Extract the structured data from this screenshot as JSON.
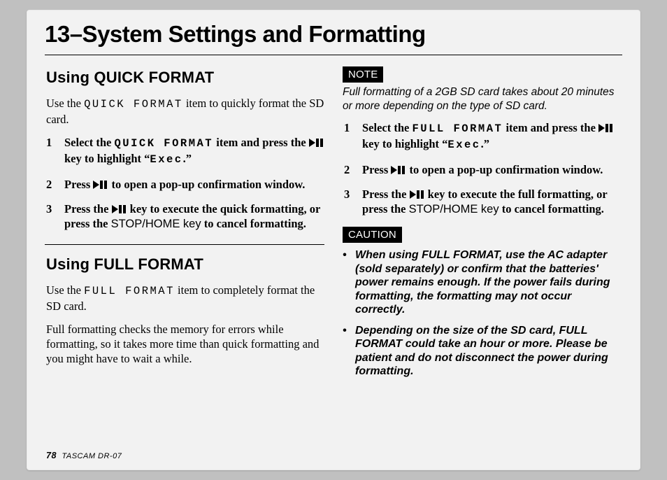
{
  "chapter_title": "13–System Settings and Formatting",
  "left": {
    "quick": {
      "heading": "Using QUICK FORMAT",
      "intro_a": "Use the ",
      "intro_code": "QUICK FORMAT",
      "intro_b": " item to quickly format the SD card.",
      "steps": [
        {
          "a": "Select the ",
          "code": "QUICK FORMAT",
          "b": " item and press the ",
          "c": " key to highlight “",
          "code2": "Exec",
          "d": ".”"
        },
        {
          "a": "Press ",
          "b": " to open a pop-up confirmation window."
        },
        {
          "a": "Press the ",
          "b": " key to execute the quick formatting, or press the ",
          "key": "STOP/HOME key",
          "c": " to cancel formatting."
        }
      ]
    },
    "full": {
      "heading": "Using FULL FORMAT",
      "intro_a": "Use the ",
      "intro_code": "FULL FORMAT",
      "intro_b": " item to completely format the SD card.",
      "para2": "Full formatting checks the memory for errors while formatting, so it takes more time than quick formatting and you might have to wait a while."
    }
  },
  "right": {
    "note_label": "NOTE",
    "note_text": "Full formatting of a 2GB SD card takes about 20 minutes or more depending on the type of SD card.",
    "steps": [
      {
        "a": "Select the ",
        "code": "FULL FORMAT",
        "b": " item and press the ",
        "c": " key to highlight “",
        "code2": "Exec",
        "d": ".”"
      },
      {
        "a": "Press ",
        "b": " to open a pop-up confirmation window."
      },
      {
        "a": "Press the ",
        "b": " key to execute the full formatting, or press the ",
        "key": "STOP/HOME key",
        "c": " to cancel formatting."
      }
    ],
    "caution_label": "CAUTION",
    "caution": [
      "When using FULL FORMAT, use the AC adapter (sold separately) or confirm that the batteries' power  remains enough. If the power fails during formatting, the formatting may not occur correctly.",
      "Depending on the size of the SD card, FULL FORMAT could take an hour or more. Please be patient and do not disconnect the power during formatting."
    ]
  },
  "footer": {
    "page": "78",
    "model": "TASCAM  DR-07"
  }
}
